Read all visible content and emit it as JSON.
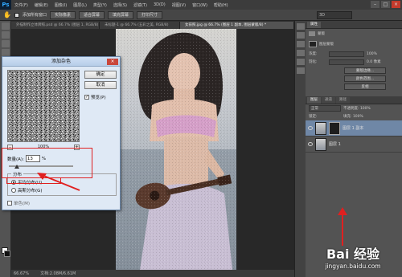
{
  "app": {
    "logo": "Ps"
  },
  "menu": [
    "文件(F)",
    "编辑(E)",
    "图像(I)",
    "图层(L)",
    "类型(Y)",
    "选择(S)",
    "滤镜(T)",
    "3D(D)",
    "视图(V)",
    "窗口(W)",
    "帮助(H)"
  ],
  "window_controls": {
    "minimize": "–",
    "maximize": "□",
    "close": "×"
  },
  "options": {
    "sample_all": "添加所有窗口",
    "buttons": [
      "实际像素",
      "适合屏幕",
      "填充屏幕",
      "打印尺寸"
    ],
    "workspace": "3D"
  },
  "tabs": [
    {
      "label": "外描制作立体牌照.psd @ 66.7% (图层 1, RGB/8)",
      "active": false
    },
    {
      "label": "未标题-1 @ 66.7% (五彩之美, RGB/8)",
      "active": false
    },
    {
      "label": "女孩照.jpg @ 66.7% (图层 1 副本, 图层蒙版/8) *",
      "active": true
    }
  ],
  "status": {
    "zoom": "66.67%",
    "doc": "文档:2.08M/6.61M"
  },
  "dialog": {
    "title": "添加杂色",
    "ok": "确定",
    "cancel": "取消",
    "preview_label": "预览(P)",
    "preview_checked": true,
    "zoom_value": "100%",
    "amount_label": "数量(A):",
    "amount_value": "13",
    "amount_unit": "%",
    "amount_fraction": 0.13,
    "distribution_label": "分布",
    "uniform_label": "平均分布(U)",
    "gaussian_label": "高斯分布(G)",
    "uniform_selected": true,
    "monochrome_label": "单色(M)",
    "monochrome_checked": false
  },
  "panels": {
    "props_tabs": [
      "属性"
    ],
    "props_title": "蒙版",
    "props_layer": "图层蒙版",
    "props_rows": [
      {
        "label": "浓度:",
        "value": "100%"
      },
      {
        "label": "羽化:",
        "value": "0.0 像素"
      }
    ],
    "props_buttons": [
      "蒙版边缘...",
      "颜色范围...",
      "反相"
    ],
    "layers_tabs": [
      "图层",
      "通道",
      "路径"
    ],
    "blend_mode": "正常",
    "opacity": "不透明度: 100%",
    "lock": "锁定:",
    "fill": "填充: 100%",
    "layers": [
      {
        "name": "图层 1 副本",
        "active": true,
        "mask": true
      },
      {
        "name": "图层 1",
        "active": false,
        "mask": false
      }
    ]
  },
  "watermark": {
    "logo": "Bai 经验",
    "url": "jingyan.baidu.com"
  },
  "colors": {
    "annotation": "#e02020",
    "active_layer": "#6f87a6",
    "dialog_bg": "#dfe9f5"
  }
}
